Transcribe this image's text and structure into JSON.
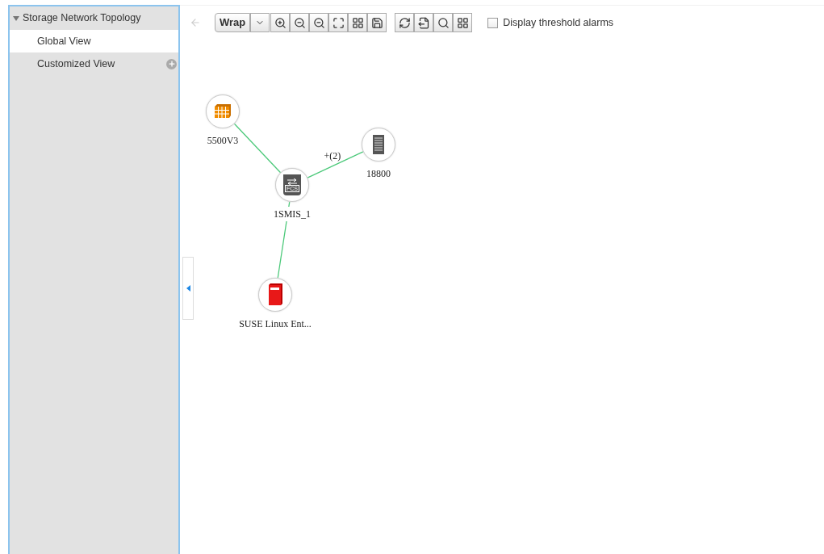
{
  "sidebar": {
    "title": "Storage Network Topology",
    "expanded": true,
    "items": [
      {
        "label": "Global View",
        "selected": true,
        "addable": false
      },
      {
        "label": "Customized View",
        "selected": false,
        "addable": true
      }
    ]
  },
  "toolbar": {
    "wrap_label": "Wrap",
    "threshold_alarms": {
      "label": "Display threshold alarms",
      "checked": false
    }
  },
  "topology": {
    "nodes": [
      {
        "kind": "storage",
        "label": "5500V3"
      },
      {
        "kind": "server",
        "label": "18800"
      },
      {
        "kind": "switch",
        "label": "1SMIS_1",
        "icon_text": "FCS"
      },
      {
        "kind": "host",
        "label": "SUSE Linux Ent..."
      }
    ],
    "link_labels": [
      "+(2)"
    ]
  }
}
